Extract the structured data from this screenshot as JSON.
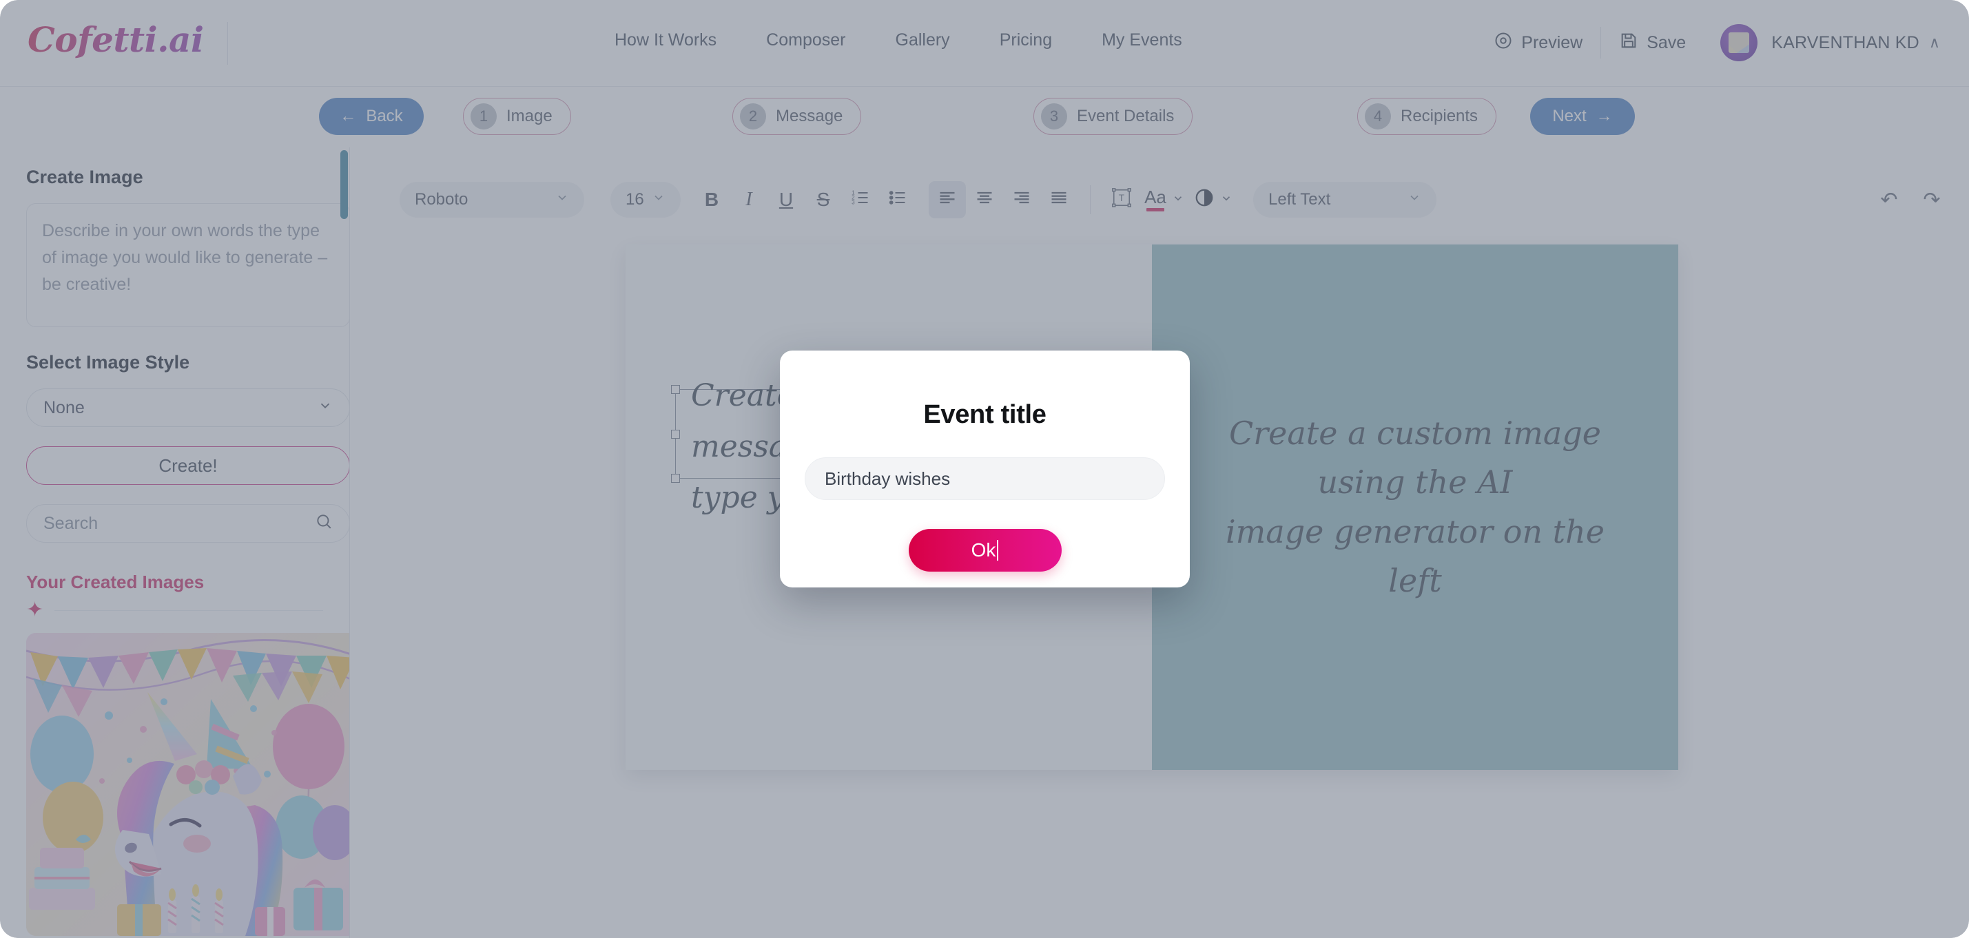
{
  "brand": {
    "logo": "Cofetti.ai"
  },
  "header": {
    "nav": [
      {
        "label": "How It Works"
      },
      {
        "label": "Composer"
      },
      {
        "label": "Gallery"
      },
      {
        "label": "Pricing"
      },
      {
        "label": "My Events"
      }
    ],
    "preview_label": "Preview",
    "save_label": "Save",
    "username": "KARVENTHAN KD",
    "user_caret": "∧"
  },
  "stepper": {
    "back_label": "Back",
    "back_icon": "←",
    "next_label": "Next",
    "next_icon": "→",
    "steps": [
      {
        "num": "1",
        "label": "Image"
      },
      {
        "num": "2",
        "label": "Message"
      },
      {
        "num": "3",
        "label": "Event Details"
      },
      {
        "num": "4",
        "label": "Recipients"
      }
    ]
  },
  "sidebar": {
    "create_image_heading": "Create Image",
    "prompt_placeholder": "Describe in your own words the type of image you would like to generate – be creative!",
    "style_heading": "Select Image Style",
    "style_value": "None",
    "style_options": [
      "None"
    ],
    "create_button": "Create!",
    "search_placeholder": "Search",
    "created_images_heading": "Your Created Images",
    "add_icon": "✦",
    "thumbnail_alt": "Unicorn birthday party illustration"
  },
  "toolbar": {
    "font_value": "Roboto",
    "size_value": "16",
    "bold": "B",
    "italic": "I",
    "underline": "U",
    "strike": "S",
    "ordered_list": "ordered-list-icon",
    "bullet_list": "bullet-list-icon",
    "align_left": "align-left-icon",
    "align_center": "align-center-icon",
    "align_right": "align-right-icon",
    "align_justify": "align-justify-icon",
    "textbox_icon": "text-box-icon",
    "text_color_label": "Aa",
    "text_color_swatch": "#d6336c",
    "opacity_icon": "contrast-icon",
    "text_layer_value": "Left Text",
    "undo_icon": "↶",
    "redo_icon": "↷"
  },
  "canvas": {
    "left_text": "Create a\nmessage\ntype you",
    "right_text_lines": [
      "Create a custom image",
      "using the AI",
      "image generator on the",
      "left"
    ],
    "right_bg": "#9ec3c8"
  },
  "modal": {
    "title": "Event title",
    "input_value": "Birthday wishes",
    "ok_label": "Ok"
  },
  "colors": {
    "accent_pink": "#cf3a72",
    "accent_magenta": "#e6138f",
    "accent_crimson": "#d80046",
    "primary_blue": "#5a8ac8",
    "teal_scrollbar": "#4d8fa6"
  }
}
